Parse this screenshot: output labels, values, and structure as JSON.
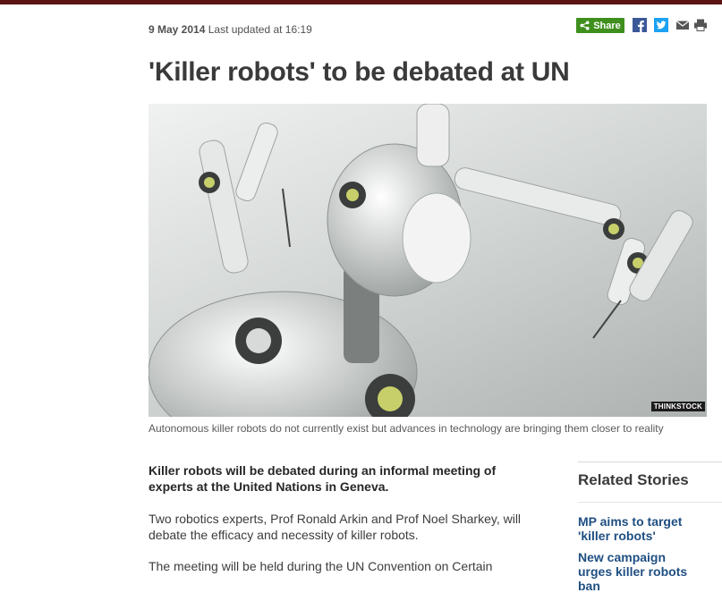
{
  "meta": {
    "date": "9 May 2014",
    "updated": "Last updated at 16:19"
  },
  "share": {
    "label": "Share"
  },
  "article": {
    "headline": "'Killer robots' to be debated at UN",
    "image_credit": "THINKSTOCK",
    "caption": "Autonomous killer robots do not currently exist but advances in technology are bringing them closer to reality",
    "intro": "Killer robots will be debated during an informal meeting of experts at the United Nations in Geneva.",
    "paragraphs": [
      "Two robotics experts, Prof Ronald Arkin and Prof Noel Sharkey, will debate the efficacy and necessity of killer robots.",
      "The meeting will be held during the UN Convention on Certain"
    ]
  },
  "related": {
    "title": "Related Stories",
    "links": [
      "MP aims to target 'killer robots'",
      "New campaign urges killer robots ban"
    ]
  },
  "colors": {
    "top_bar": "#5a1414",
    "share_green": "#3f8f1d",
    "link_blue": "#1f4f82"
  }
}
